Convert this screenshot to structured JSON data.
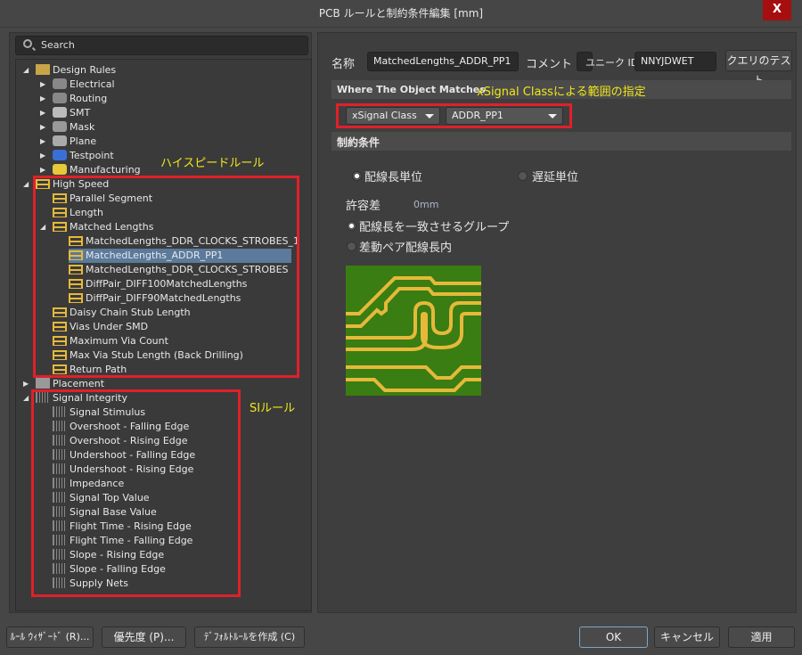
{
  "window": {
    "title": "PCB ルールと制約条件編集 [mm]",
    "close_label": "X"
  },
  "search": {
    "placeholder": "Search"
  },
  "tree": {
    "root": "Design Rules",
    "categories": [
      "Electrical",
      "Routing",
      "SMT",
      "Mask",
      "Plane",
      "Testpoint",
      "Manufacturing"
    ],
    "high_speed": {
      "label": "High Speed",
      "children": [
        "Parallel Segment",
        "Length"
      ],
      "matched": {
        "label": "Matched Lengths",
        "children": [
          "MatchedLengths_DDR_CLOCKS_STROBES_1",
          "MatchedLengths_ADDR_PP1",
          "MatchedLengths_DDR_CLOCKS_STROBES",
          "DiffPair_DIFF100MatchedLengths",
          "DiffPair_DIFF90MatchedLengths"
        ]
      },
      "after": [
        "Daisy Chain Stub Length",
        "Vias Under SMD",
        "Maximum Via Count",
        "Max Via Stub Length (Back Drilling)",
        "Return Path"
      ]
    },
    "placement": "Placement",
    "signal_integrity": {
      "label": "Signal Integrity",
      "children": [
        "Signal Stimulus",
        "Overshoot - Falling Edge",
        "Overshoot - Rising Edge",
        "Undershoot - Falling Edge",
        "Undershoot - Rising Edge",
        "Impedance",
        "Signal Top Value",
        "Signal Base Value",
        "Flight Time - Rising Edge",
        "Flight Time - Falling Edge",
        "Slope - Rising Edge",
        "Slope - Falling Edge",
        "Supply Nets"
      ]
    },
    "selected": "MatchedLengths_ADDR_PP1"
  },
  "annotations": {
    "high_speed": "ハイスピードルール",
    "si": "SIルール",
    "scope": "xSignal Classによる範囲の指定"
  },
  "rule": {
    "name_label": "名称",
    "name_value": "MatchedLengths_ADDR_PP1",
    "comment_label": "コメント",
    "comment_value": "",
    "uid_label": "ユニーク ID",
    "uid_value": "NNYJDWET",
    "query_button": "クエリのテスト",
    "where_header": "Where The Object Matches",
    "scope_type": "xSignal Class",
    "scope_value": "ADDR_PP1",
    "constraints_header": "制約条件",
    "unit_length": "配線長単位",
    "unit_delay": "遅延単位",
    "tolerance_label": "許容差",
    "tolerance_value": "0mm",
    "opt_group": "配線長を一致させるグループ",
    "opt_diff": "差動ペア配線長内"
  },
  "buttons": {
    "wizard": "ﾙｰﾙ ｳｨｻﾞｰﾄﾞ (R)...",
    "priority": "優先度 (P)...",
    "default": "ﾃﾞﾌｫﾙﾄﾙｰﾙを作成 (C)",
    "ok": "OK",
    "cancel": "キャンセル",
    "apply": "適用"
  }
}
